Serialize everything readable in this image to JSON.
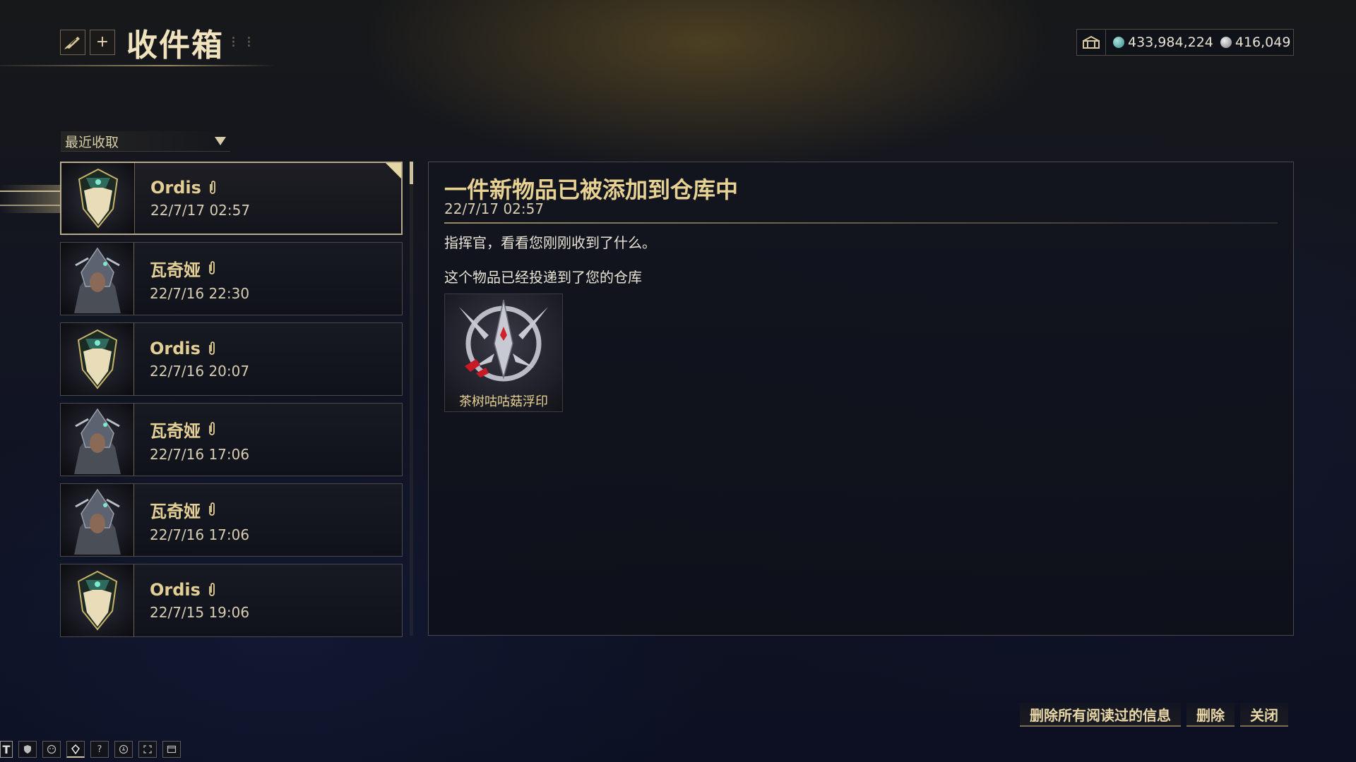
{
  "header": {
    "title": "收件箱",
    "add_label": "+"
  },
  "currency": {
    "credits": "433,984,224",
    "endo": "416,049"
  },
  "sort": {
    "label": "最近收取"
  },
  "messages": [
    {
      "sender": "Ordis",
      "date": "22/7/17 02:57",
      "avatar": "ordis",
      "selected": true
    },
    {
      "sender": "瓦奇娅",
      "date": "22/7/16 22:30",
      "avatar": "vaykor"
    },
    {
      "sender": "Ordis",
      "date": "22/7/16 20:07",
      "avatar": "ordis"
    },
    {
      "sender": "瓦奇娅",
      "date": "22/7/16 17:06",
      "avatar": "vaykor"
    },
    {
      "sender": "瓦奇娅",
      "date": "22/7/16 17:06",
      "avatar": "vaykor"
    },
    {
      "sender": "Ordis",
      "date": "22/7/15 19:06",
      "avatar": "ordis"
    }
  ],
  "detail": {
    "title": "一件新物品已被添加到仓库中",
    "date": "22/7/17 02:57",
    "line1": "指挥官，看看您刚刚收到了什么。",
    "line2": "这个物品已经投递到了您的仓库",
    "attachment": {
      "label": "茶树咕咕菇浮印",
      "icon": "sigil-icon"
    }
  },
  "buttons": {
    "delete_read": "删除所有阅读过的信息",
    "delete": "删除",
    "close": "关闭"
  },
  "taskbar": {
    "first": "T",
    "help": "?"
  },
  "colors": {
    "gold": "#e3cf95",
    "panel_border": "#4a4a4a",
    "selected_border": "#b7ab8c"
  }
}
